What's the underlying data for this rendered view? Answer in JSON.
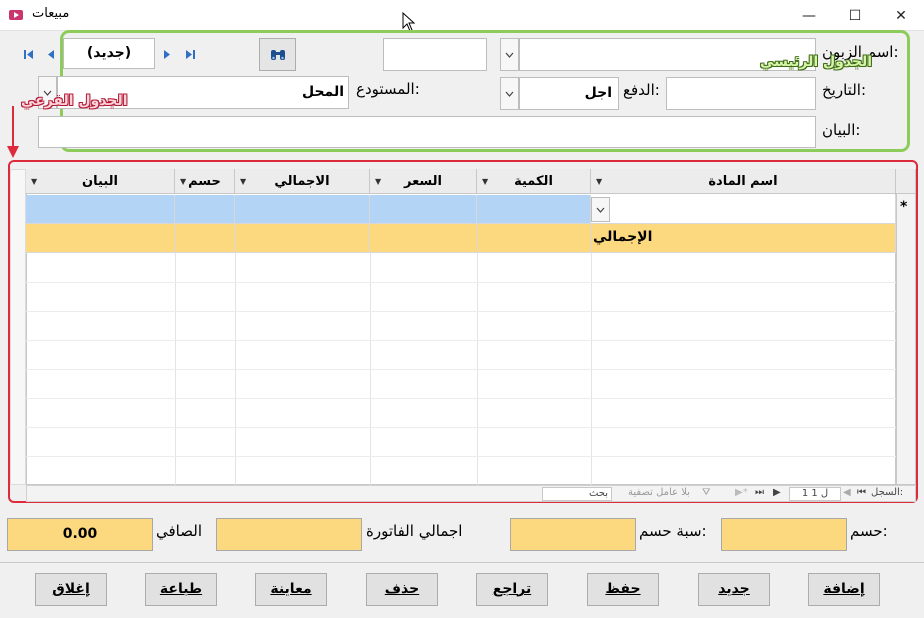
{
  "window": {
    "title": "مبيعات",
    "minimize": "—",
    "maximize": "☐",
    "close": "✕"
  },
  "navigator": {
    "first": "⏮",
    "prev": "◀",
    "record": "(جديد)",
    "next": "▶",
    "last": "⏭"
  },
  "header": {
    "customer_label": "اسم الزبون:",
    "customer_value": "",
    "date_label": "التاريخ:",
    "date_value": "",
    "payment_label": "الدفع:",
    "payment_value": "اجل",
    "warehouse_label": "المستودع:",
    "warehouse_value": "المحل",
    "statement_label": "البيان:",
    "statement_value": "",
    "annotation_main": "الجدول الرئيسي",
    "annotation_sub": "الجدول الفرعي"
  },
  "grid": {
    "columns": [
      "اسم المادة",
      "الكمية",
      "السعر",
      "الاجمالي",
      "حسم",
      "البيان"
    ],
    "new_row_marker": "*",
    "total_row_label": "الإجمالي"
  },
  "navbar": {
    "record_label": "السجل:",
    "current": "1 ل 1",
    "filter_label": "بلا عامل تصفية",
    "search_label": "بحث"
  },
  "totals": {
    "discount_label": "حسم:",
    "discount_value": "",
    "discount_pct_label": "سبة حسم:",
    "discount_pct_value": "",
    "invoice_total_label": "اجمالي الفاتورة",
    "invoice_total_value": "",
    "net_label": "الصافي",
    "net_value": "0.00"
  },
  "actions": [
    "إضافة",
    "جديد",
    "حفظ",
    "تراجع",
    "حذف",
    "معاينة",
    "طباعة",
    "إغلاق"
  ],
  "colors": {
    "main_frame": "#8dcc5a",
    "sub_frame": "#dd2b3c",
    "new_row": "#b3d4f5",
    "total_row": "#fcd97f"
  }
}
